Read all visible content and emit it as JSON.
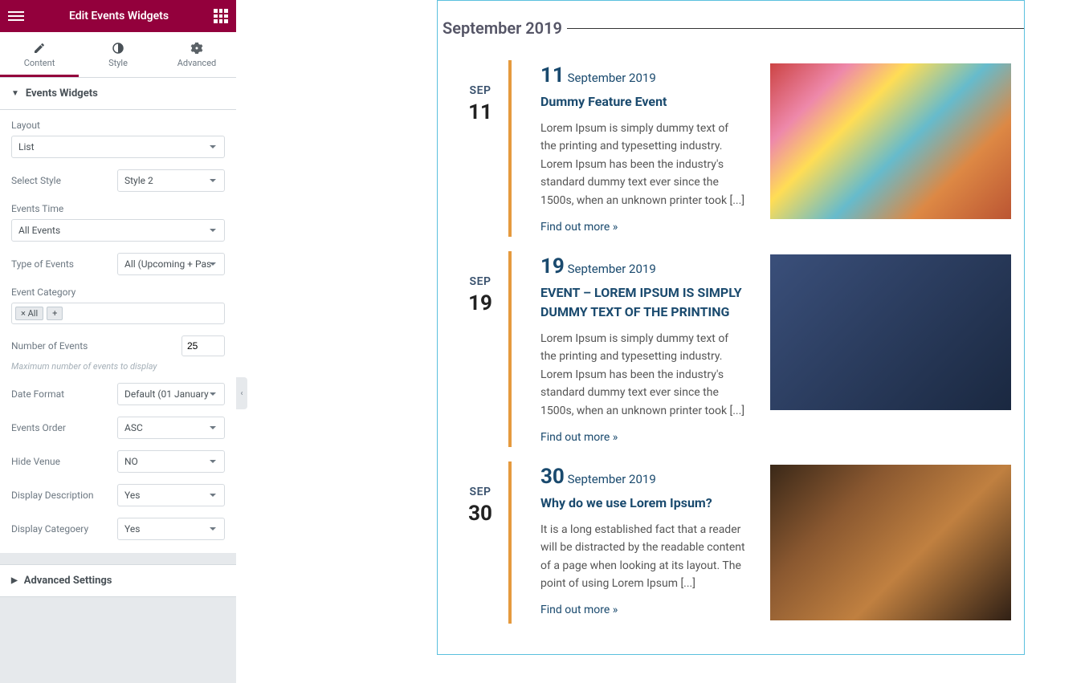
{
  "header": {
    "title": "Edit Events Widgets"
  },
  "tabs": {
    "content": "Content",
    "style": "Style",
    "advanced": "Advanced"
  },
  "section": {
    "title": "Events Widgets",
    "advanced": "Advanced Settings"
  },
  "fields": {
    "layout": {
      "label": "Layout",
      "value": "List"
    },
    "selectStyle": {
      "label": "Select Style",
      "value": "Style 2"
    },
    "eventsTime": {
      "label": "Events Time",
      "value": "All Events"
    },
    "typeEvents": {
      "label": "Type of Events",
      "value": "All (Upcoming + Pas"
    },
    "eventCategory": {
      "label": "Event Category",
      "tag": "× All",
      "add": "+"
    },
    "numEvents": {
      "label": "Number of Events",
      "value": "25",
      "hint": "Maximum number of events to display"
    },
    "dateFormat": {
      "label": "Date Format",
      "value": "Default (01 January"
    },
    "eventsOrder": {
      "label": "Events Order",
      "value": "ASC"
    },
    "hideVenue": {
      "label": "Hide Venue",
      "value": "NO"
    },
    "displayDesc": {
      "label": "Display Description",
      "value": "Yes"
    },
    "displayCat": {
      "label": "Display Categoery",
      "value": "Yes"
    }
  },
  "preview": {
    "monthTitle": "September 2019",
    "events": [
      {
        "mon": "SEP",
        "dayBig": "11",
        "dn": "11",
        "dsuffix": "September 2019",
        "title": "Dummy Feature Event",
        "desc": "Lorem Ipsum is simply dummy text of the printing and typesetting industry. Lorem Ipsum has been the industry's standard dummy text ever since the 1500s, when an unknown printer took [...]",
        "link": "Find out more »"
      },
      {
        "mon": "SEP",
        "dayBig": "19",
        "dn": "19",
        "dsuffix": "September 2019",
        "title": "EVENT – LOREM IPSUM IS SIMPLY DUMMY TEXT OF THE PRINTING",
        "desc": "Lorem Ipsum is simply dummy text of the printing and typesetting industry. Lorem Ipsum has been the industry's standard dummy text ever since the 1500s, when an unknown printer took [...]",
        "link": "Find out more »"
      },
      {
        "mon": "SEP",
        "dayBig": "30",
        "dn": "30",
        "dsuffix": "September 2019",
        "title": "Why do we use Lorem Ipsum?",
        "desc": "It is a long established fact that a reader will be distracted by the readable content of a page when looking at its layout. The point of using Lorem Ipsum [...]",
        "link": "Find out more »"
      }
    ]
  }
}
